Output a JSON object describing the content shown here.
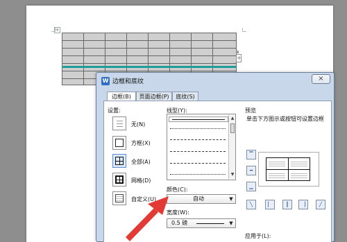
{
  "dialog": {
    "title": "边框和底纹",
    "close_icon": "close-icon",
    "tabs": [
      {
        "label": "边框(B)"
      },
      {
        "label": "页面边框(P)"
      },
      {
        "label": "底纹(S)"
      }
    ]
  },
  "settings": {
    "label": "设置:",
    "options": [
      {
        "label": "无(N)",
        "icon": "none-border-icon"
      },
      {
        "label": "方框(X)",
        "icon": "box-border-icon"
      },
      {
        "label": "全部(A)",
        "icon": "all-border-icon"
      },
      {
        "label": "网格(D)",
        "icon": "grid-border-icon"
      },
      {
        "label": "自定义(U)",
        "icon": "custom-border-icon"
      }
    ]
  },
  "line_style": {
    "label": "线型(Y):"
  },
  "color": {
    "label": "颜色(C):",
    "value": "自动"
  },
  "width": {
    "label": "宽度(W):",
    "value": "0.5 磅"
  },
  "preview": {
    "label": "预览",
    "hint": "单击下方图示或按钮可设置边框"
  },
  "apply_to": {
    "label": "应用于(L):"
  },
  "document": {
    "table_handle": "+",
    "add_button": "+"
  },
  "accent_color": "#1f9d9b",
  "arrow_color": "#e23b35"
}
